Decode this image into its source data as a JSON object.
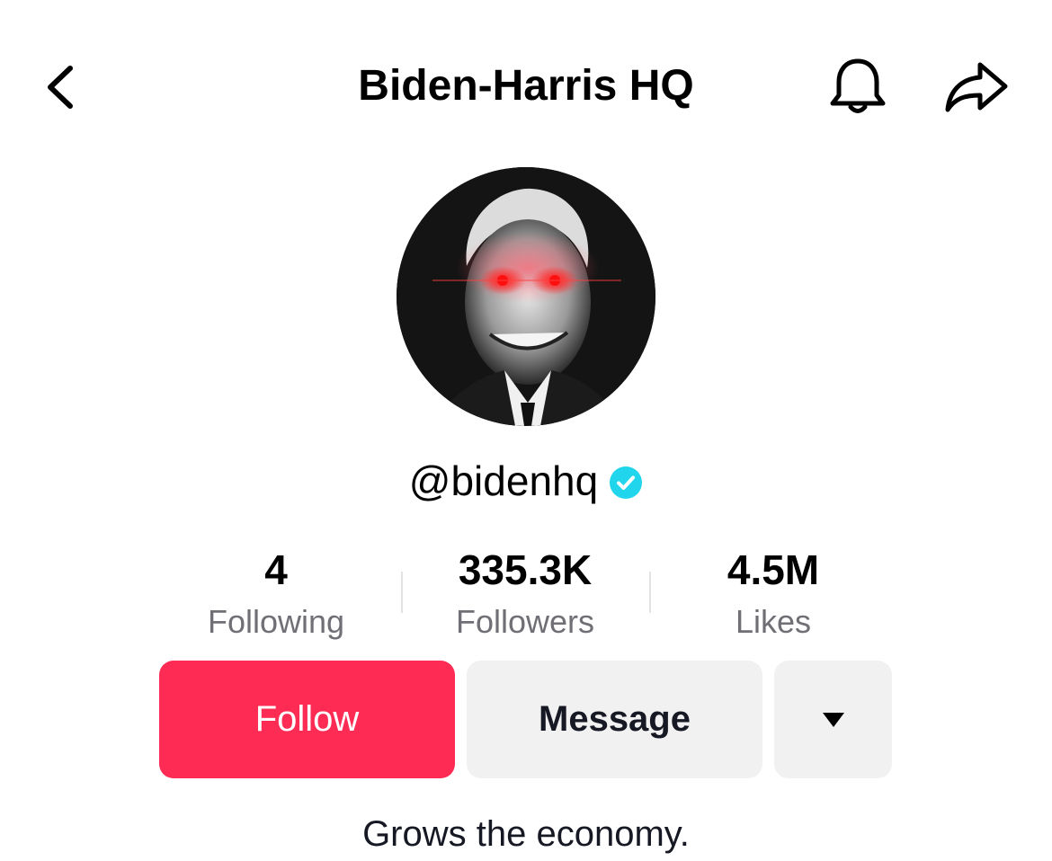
{
  "header": {
    "title": "Biden-Harris HQ",
    "back_icon": "chevron-left-icon",
    "notification_icon": "bell-icon",
    "share_icon": "share-arrow-icon"
  },
  "profile": {
    "avatar_description_icon": "avatar-photo",
    "username": "@bidenhq",
    "verified_icon": "verified-badge-icon",
    "verified_color": "#20d5ec",
    "bio": "Grows the economy."
  },
  "stats": [
    {
      "value": "4",
      "label": "Following"
    },
    {
      "value": "335.3K",
      "label": "Followers"
    },
    {
      "value": "4.5M",
      "label": "Likes"
    }
  ],
  "actions": {
    "follow_label": "Follow",
    "message_label": "Message",
    "more_icon": "triangle-down-icon",
    "follow_color": "#fe2c55",
    "secondary_color": "#f1f1f2"
  }
}
